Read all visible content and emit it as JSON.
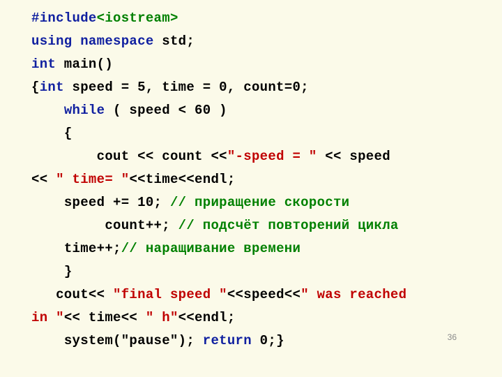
{
  "code": {
    "l1_include": "#include",
    "l1_header": "<iostream>",
    "l2_using": "using",
    "l2_namespace": "namespace",
    "l2_std": " std;",
    "l3_int": "int",
    "l3_main": " main()",
    "l4_brace": "{",
    "l4_int": "int",
    "l4_decl": " speed = 5, time = 0, count=0;",
    "l5_while": "while",
    "l5_cond": " ( speed < 60 )",
    "l6_brace": "{",
    "l7_cout": "cout << count <<",
    "l7_str": "\"-speed = \"",
    "l7_tail": " << speed",
    "l8_lead": "<< ",
    "l8_str": "\" time= \"",
    "l8_tail": "<<time<<endl;",
    "l9_speed": "speed += 10; ",
    "l9_cmt": "// приращение скорости",
    "l10_count": "count++; ",
    "l10_cmt": "// подсчёт повторений цикла",
    "l11_time": "time++;",
    "l11_cmt": "// наращивание времени",
    "l12_brace": "}",
    "l13_cout": "cout<< ",
    "l13_str1": "\"final speed \"",
    "l13_mid": "<<speed<<",
    "l13_str2": "\" was reached ",
    "l14_str2b": "in \"",
    "l14_mid": "<< time<< ",
    "l14_str3": "\" h\"",
    "l14_tail": "<<endl;",
    "l15_sys": "system(\"pause\");    ",
    "l15_return": "return",
    "l15_tail": " 0;}"
  },
  "page_number": "36"
}
